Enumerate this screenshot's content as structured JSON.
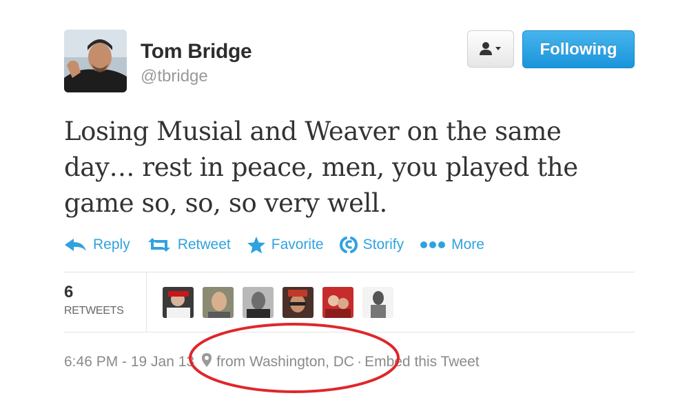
{
  "user": {
    "name": "Tom Bridge",
    "handle": "@tbridge"
  },
  "header_buttons": {
    "user_menu_icon": "person-dropdown-icon",
    "follow_label": "Following"
  },
  "tweet": {
    "text": "Losing Musial and Weaver on the same day… rest in peace, men, you played the game so, so, so very well."
  },
  "actions": [
    {
      "label": "Reply",
      "icon": "reply-icon"
    },
    {
      "label": "Retweet",
      "icon": "retweet-icon"
    },
    {
      "label": "Favorite",
      "icon": "star-icon"
    },
    {
      "label": "Storify",
      "icon": "storify-icon"
    },
    {
      "label": "More",
      "icon": "more-dots-icon"
    }
  ],
  "stats": {
    "retweet_count": "6",
    "retweet_label": "RETWEETS"
  },
  "meta": {
    "timestamp": "6:46 PM - 19 Jan 13",
    "location": "from Washington, DC",
    "separator": "·",
    "embed_label": "Embed this Tweet"
  },
  "colors": {
    "accent": "#2fa2e0",
    "follow_button": "#1a95da",
    "highlight_circle": "#e0262b"
  }
}
